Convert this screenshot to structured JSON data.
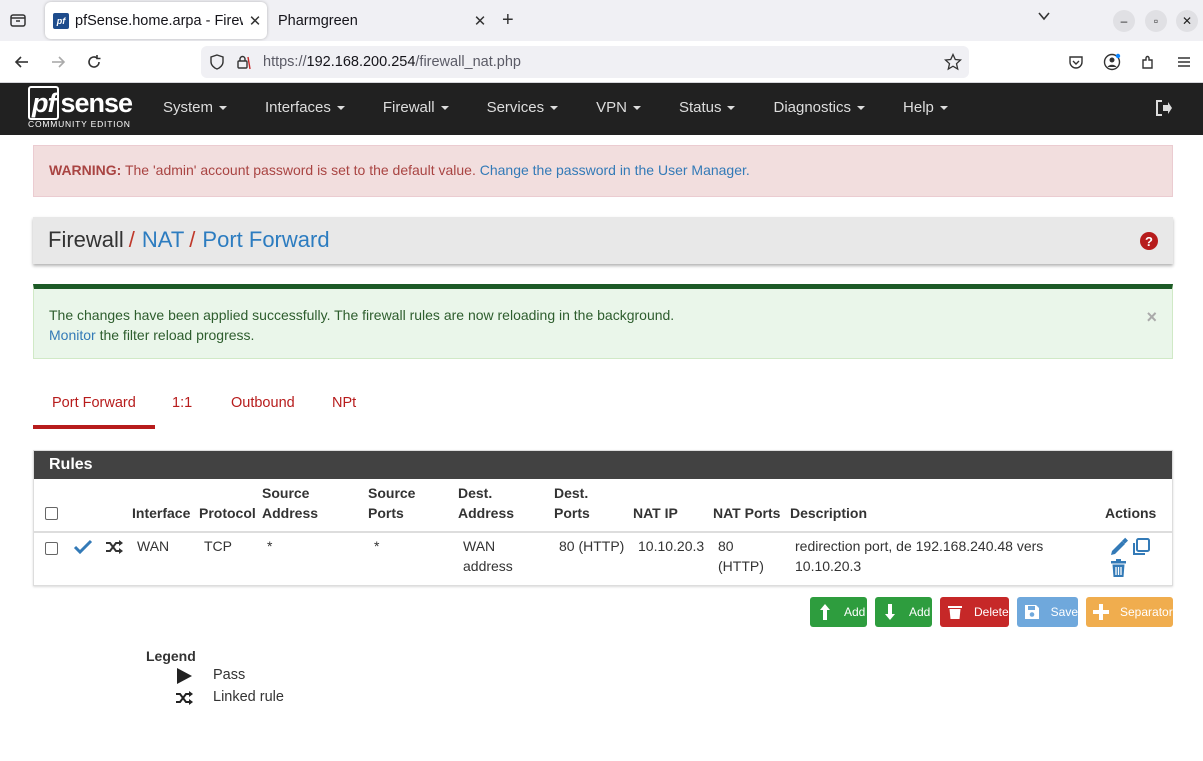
{
  "browser": {
    "active_tab_title": "pfSense.home.arpa - Firew",
    "inactive_tab_title": "Pharmgreen",
    "favicon_text": "pf",
    "url_prefix": "https://",
    "url_host": "192.168.200.254",
    "url_path": "/firewall_nat.php"
  },
  "header": {
    "logo_pf": "pf",
    "logo_rest": "sense",
    "logo_sub": "COMMUNITY EDITION",
    "menu": [
      "System",
      "Interfaces",
      "Firewall",
      "Services",
      "VPN",
      "Status",
      "Diagnostics",
      "Help"
    ]
  },
  "warning": {
    "label": "WARNING:",
    "text": " The 'admin' account password is set to the default value. ",
    "link": "Change the password in the User Manager."
  },
  "breadcrumb": {
    "level1": "Firewall",
    "sep": "/",
    "level2": "NAT",
    "level3": "Port Forward"
  },
  "success": {
    "line1": "The changes have been applied successfully. The firewall rules are now reloading in the background.",
    "link": "Monitor",
    "line2_rest": " the filter reload progress.",
    "close": "×"
  },
  "tabs": [
    "Port Forward",
    "1:1",
    "Outbound",
    "NPt"
  ],
  "rules": {
    "panel_title": "Rules",
    "headers": {
      "interface": "Interface",
      "protocol": "Protocol",
      "src_addr_1": "Source",
      "src_addr_2": "Address",
      "src_ports_1": "Source",
      "src_ports_2": "Ports",
      "dst_addr_1": "Dest.",
      "dst_addr_2": "Address",
      "dst_ports_1": "Dest.",
      "dst_ports_2": "Ports",
      "nat_ip": "NAT IP",
      "nat_ports": "NAT Ports",
      "description": "Description",
      "actions": "Actions"
    },
    "row": {
      "interface": "WAN",
      "protocol": "TCP",
      "src_addr": "*",
      "src_ports": "*",
      "dst_addr_1": "WAN",
      "dst_addr_2": "address",
      "dst_ports": "80 (HTTP)",
      "nat_ip": "10.10.20.3",
      "nat_ports_1": "80",
      "nat_ports_2": "(HTTP)",
      "description_1": "redirection port, de 192.168.240.48 vers",
      "description_2": "10.10.20.3"
    }
  },
  "buttons": {
    "add_top": "Add",
    "add_bottom": "Add",
    "delete": "Delete",
    "save": "Save",
    "separator": "Separator"
  },
  "legend": {
    "title": "Legend",
    "pass": "Pass",
    "linked": "Linked rule"
  },
  "colors": {
    "header_bg": "#212121",
    "accent_red": "#b71c1c",
    "link_blue": "#337ab7",
    "green_button": "#2e9d3e"
  }
}
